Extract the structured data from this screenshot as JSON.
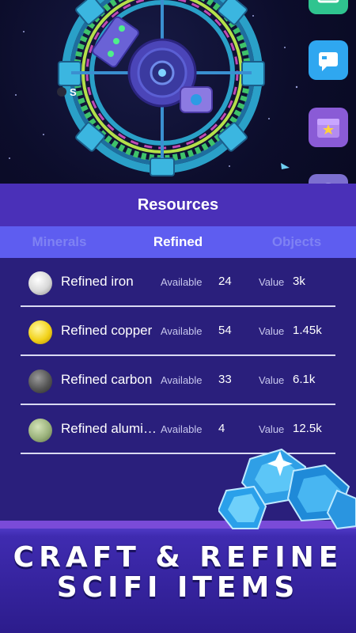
{
  "panel": {
    "title": "Resources",
    "tabs": [
      {
        "label": "Minerals",
        "active": false
      },
      {
        "label": "Refined",
        "active": true
      },
      {
        "label": "Objects",
        "active": false
      }
    ],
    "available_label": "Available",
    "value_label": "Value",
    "items": [
      {
        "name": "Refined iron",
        "quantity": "24",
        "value": "3k",
        "color": "#e8e8e8"
      },
      {
        "name": "Refined copper",
        "quantity": "54",
        "value": "1.45k",
        "color": "#f2d21a"
      },
      {
        "name": "Refined carbon",
        "quantity": "33",
        "value": "6.1k",
        "color": "#5a5a5a"
      },
      {
        "name": "Refined alumi…",
        "quantity": "4",
        "value": "12.5k",
        "color": "#9bb27c"
      }
    ]
  },
  "station_marker": "S",
  "banner": {
    "line1": "CRAFT & REFINE",
    "line2": "SCIFI ITEMS"
  },
  "colors": {
    "panel_bg": "#2a1f7c",
    "title_bar": "#4a30b8",
    "tab_bar": "#5e5df0",
    "gem": "#37b8f5"
  }
}
